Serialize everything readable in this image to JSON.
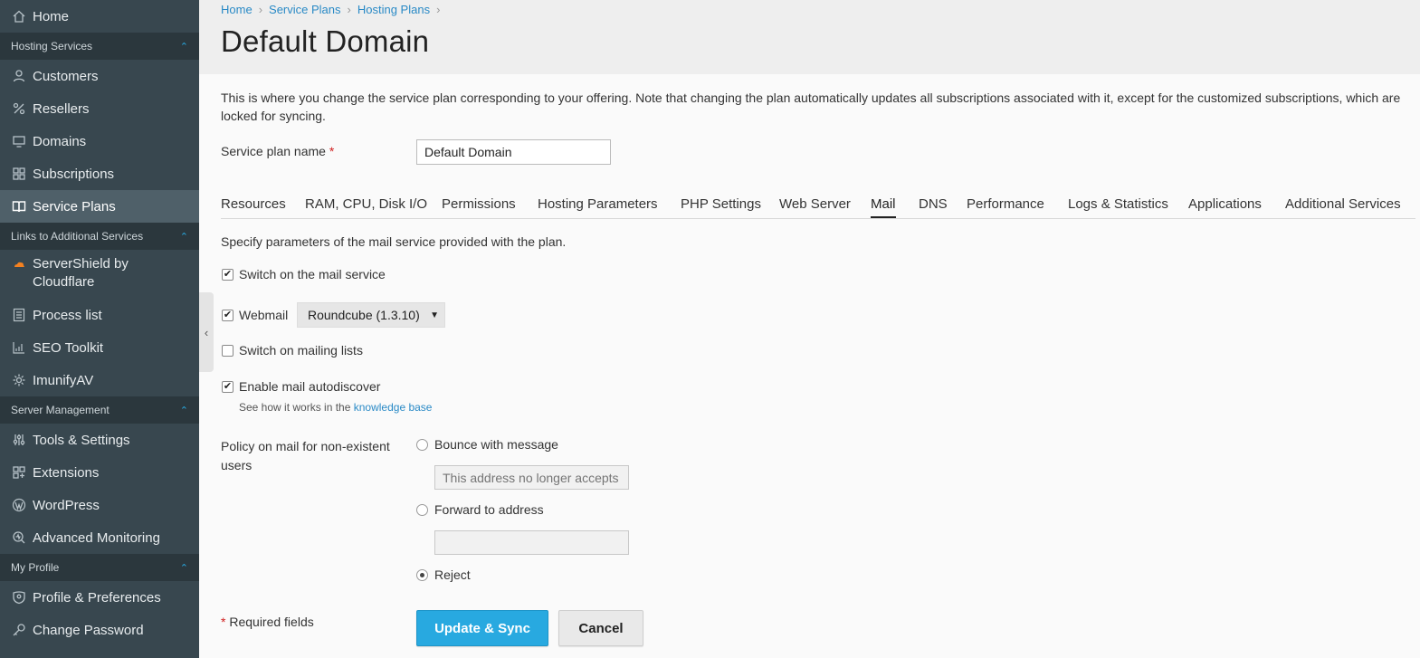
{
  "sidebar": {
    "home": "Home",
    "groups": {
      "hosting": "Hosting Services",
      "links": "Links to Additional Services",
      "server": "Server Management",
      "profile": "My Profile"
    },
    "items": {
      "customers": "Customers",
      "resellers": "Resellers",
      "domains": "Domains",
      "subscriptions": "Subscriptions",
      "service_plans": "Service Plans",
      "servershield_line1": "ServerShield by",
      "servershield_line2": "Cloudflare",
      "process_list": "Process list",
      "seo_toolkit": "SEO Toolkit",
      "imunifyav": "ImunifyAV",
      "tools_settings": "Tools & Settings",
      "extensions": "Extensions",
      "wordpress": "WordPress",
      "advanced_monitoring": "Advanced Monitoring",
      "profile_preferences": "Profile & Preferences",
      "change_password": "Change Password"
    }
  },
  "breadcrumb": [
    "Home",
    "Service Plans",
    "Hosting Plans"
  ],
  "page_title": "Default Domain",
  "intro": "This is where you change the service plan corresponding to your offering. Note that changing the plan automatically updates all subscriptions associated with it, except for the customized subscriptions, which are locked for syncing.",
  "form": {
    "plan_name_label": "Service plan name",
    "required_mark": "*",
    "plan_name_value": "Default Domain"
  },
  "tabs": [
    "Resources",
    "RAM, CPU, Disk I/O",
    "Permissions",
    "Hosting Parameters",
    "PHP Settings",
    "Web Server",
    "Mail",
    "DNS",
    "Performance",
    "Logs & Statistics",
    "Applications",
    "Additional Services"
  ],
  "active_tab": "Mail",
  "mail": {
    "description": "Specify parameters of the mail service provided with the plan.",
    "switch_on_mail": {
      "label": "Switch on the mail service",
      "checked": true
    },
    "webmail": {
      "label": "Webmail",
      "checked": true,
      "selected": "Roundcube (1.3.10)"
    },
    "mailing_lists": {
      "label": "Switch on mailing lists",
      "checked": false
    },
    "autodiscover": {
      "label": "Enable mail autodiscover",
      "checked": true
    },
    "hint_prefix": "See how it works in the",
    "hint_link": "knowledge base",
    "policy_label_line1": "Policy on mail for non-existent",
    "policy_label_line2": "users",
    "bounce_label": "Bounce with message",
    "bounce_placeholder": "This address no longer accepts mail.",
    "forward_label": "Forward to address",
    "forward_value": "",
    "reject_label": "Reject",
    "selected_policy": "Reject"
  },
  "footer": {
    "required_mark": "*",
    "required_text": "Required fields",
    "update_button": "Update & Sync",
    "cancel_button": "Cancel"
  },
  "colors": {
    "sidebar_bg": "#38474f",
    "sidebar_group_bg": "#2b373d",
    "sidebar_active_bg": "#4f6069",
    "accent": "#28a9e0",
    "link": "#2a8ac6"
  }
}
